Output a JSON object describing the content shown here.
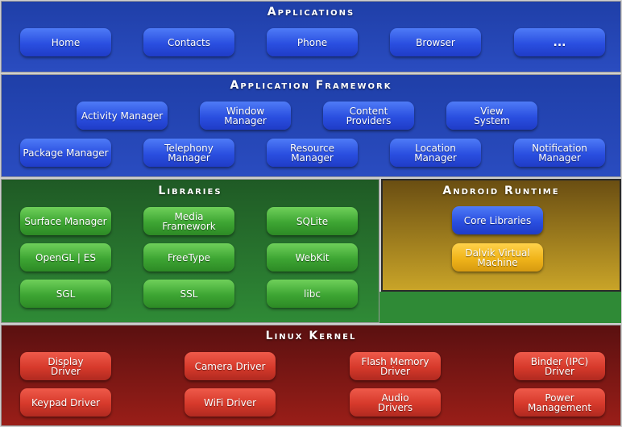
{
  "colors": {
    "applications": "#2a4cc0",
    "framework": "#2a4cc0",
    "libraries": "#2f8a36",
    "runtime": "#c9a428",
    "kernel": "#9a1e18"
  },
  "applications": {
    "title": "Applications",
    "items": [
      "Home",
      "Contacts",
      "Phone",
      "Browser",
      "..."
    ]
  },
  "framework": {
    "title": "Application Framework",
    "row1": [
      "Activity Manager",
      "Window\nManager",
      "Content\nProviders",
      "View\nSystem"
    ],
    "row2": [
      "Package Manager",
      "Telephony\nManager",
      "Resource\nManager",
      "Location\nManager",
      "Notification\nManager"
    ]
  },
  "libraries": {
    "title": "Libraries",
    "items": [
      "Surface Manager",
      "Media\nFramework",
      "SQLite",
      "OpenGL | ES",
      "FreeType",
      "WebKit",
      "SGL",
      "SSL",
      "libc"
    ]
  },
  "runtime": {
    "title": "Android Runtime",
    "items": [
      "Core Libraries",
      "Dalvik Virtual\nMachine"
    ]
  },
  "kernel": {
    "title": "Linux Kernel",
    "items": [
      "Display\nDriver",
      "Camera Driver",
      "Flash Memory\nDriver",
      "Binder (IPC)\nDriver",
      "Keypad Driver",
      "WiFi Driver",
      "Audio\nDrivers",
      "Power\nManagement"
    ]
  }
}
